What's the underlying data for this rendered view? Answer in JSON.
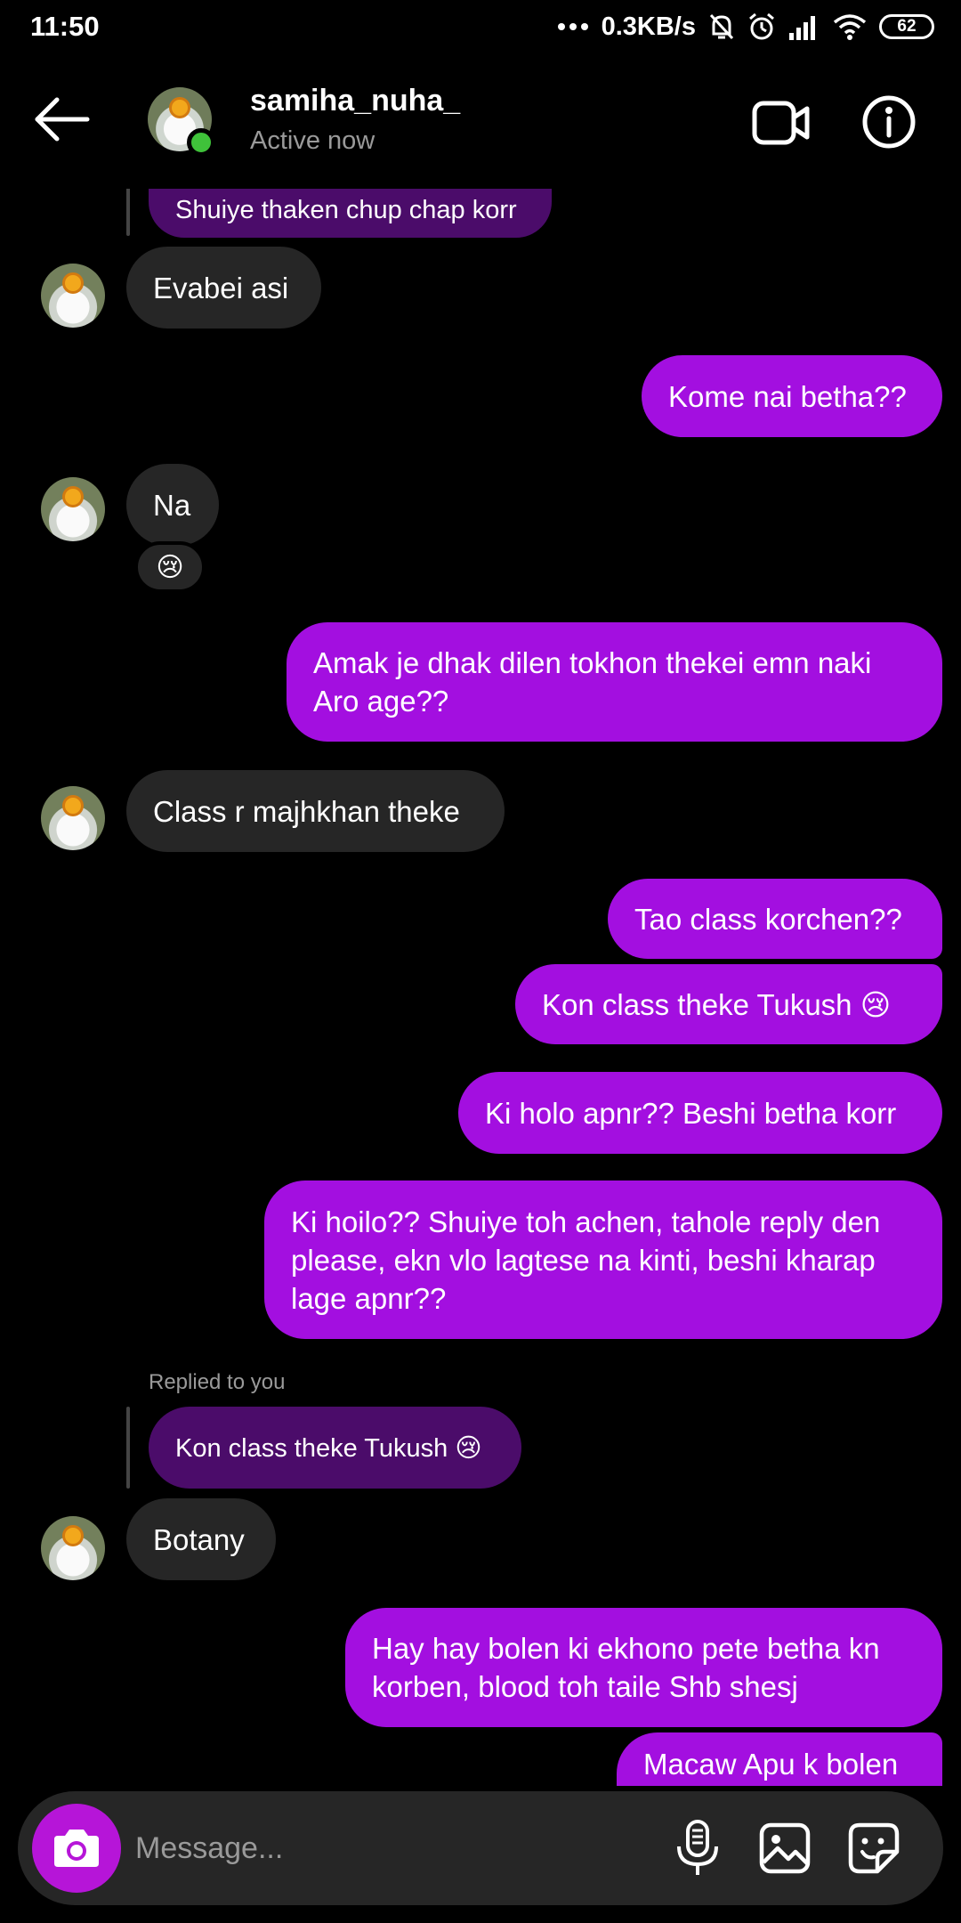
{
  "status_bar": {
    "time": "11:50",
    "network_speed": "0.3KB/s",
    "battery": "62",
    "icons": [
      "more-dots-icon",
      "mute-bell-icon",
      "alarm-icon",
      "signal-icon",
      "wifi-icon",
      "battery-icon"
    ]
  },
  "header": {
    "username": "samiha_nuha_",
    "status": "Active now",
    "icons": [
      "back-arrow-icon",
      "video-call-icon",
      "info-icon"
    ]
  },
  "messages": {
    "m0": "Shuiye thaken chup chap korr",
    "m1": "Evabei asi",
    "m2": "Kome nai betha??",
    "m3": "Na",
    "m3_reaction": "😢",
    "m4_line1": "Amak je dhak dilen tokhon thekei emn naki",
    "m4_line2": "Aro age??",
    "m5": "Class r majhkhan theke",
    "m6": "Tao class korchen??",
    "m7": "Kon class theke Tukush 😢",
    "m8": "Ki holo apnr?? Beshi betha korr",
    "m9_line1": "Ki hoilo?? Shuiye toh achen, tahole reply den",
    "m9_line2": "please, ekn vlo lagtese na kinti, beshi kharap",
    "m9_line3": "lage apnr??",
    "reply_label": "Replied to you",
    "m10_quote": "Kon class theke Tukush 😢",
    "m11": "Botany",
    "m12_line1": "Hay hay bolen ki ekhono pete betha kn",
    "m12_line2": "korben, blood toh taile Shb shesj",
    "m13": "Macaw Apu k bolen"
  },
  "composer": {
    "placeholder": "Message...",
    "icons": [
      "camera-icon",
      "microphone-icon",
      "gallery-icon",
      "sticker-icon"
    ]
  },
  "colors": {
    "outgoing_bubble": "#a30fe0",
    "incoming_bubble": "#262626",
    "quoted_bubble": "#4b0c6a",
    "camera_button": "#b615d8",
    "online_dot": "#3fc23a"
  }
}
